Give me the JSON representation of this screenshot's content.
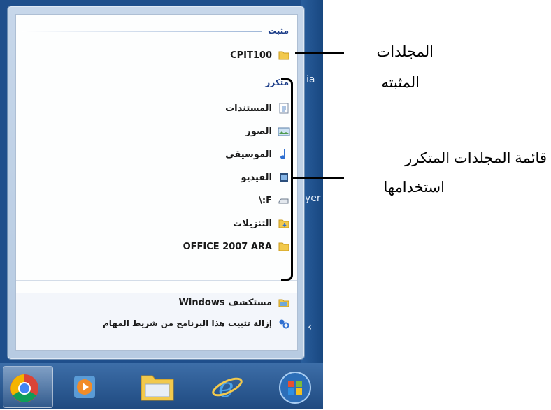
{
  "desktop": {
    "side_text_1": "ia",
    "side_text_2": "yer"
  },
  "jumplist": {
    "pinned_header": "مثبت",
    "pinned_items": [
      {
        "label": "CPIT100",
        "icon": "folder-icon"
      }
    ],
    "frequent_header": "متكرر",
    "frequent_items": [
      {
        "label": "المستندات",
        "icon": "documents-icon"
      },
      {
        "label": "الصور",
        "icon": "pictures-icon"
      },
      {
        "label": "الموسيقى",
        "icon": "music-icon"
      },
      {
        "label": "الفيديو",
        "icon": "video-icon"
      },
      {
        "label": "F:\\",
        "icon": "drive-icon"
      },
      {
        "label": "التنزيلات",
        "icon": "downloads-folder-icon"
      },
      {
        "label": "OFFICE 2007 ARA",
        "icon": "folder-icon"
      }
    ],
    "tasks": [
      {
        "label": "مستكشف Windows",
        "icon": "explorer-icon"
      },
      {
        "label": "إزالة تثبيت هذا البرنامج من شريط المهام",
        "icon": "unpin-icon"
      }
    ]
  },
  "annotations": {
    "pinned_label_1": "المجلدات",
    "pinned_label_2": "المثبته",
    "frequent_label_1": "قائمة المجلدات المتكرر",
    "frequent_label_2": "استخدامها"
  },
  "taskbar": {
    "buttons": [
      "chrome-icon",
      "media-player-icon",
      "explorer-folder-icon",
      "internet-explorer-icon",
      "start-orb-icon"
    ]
  }
}
